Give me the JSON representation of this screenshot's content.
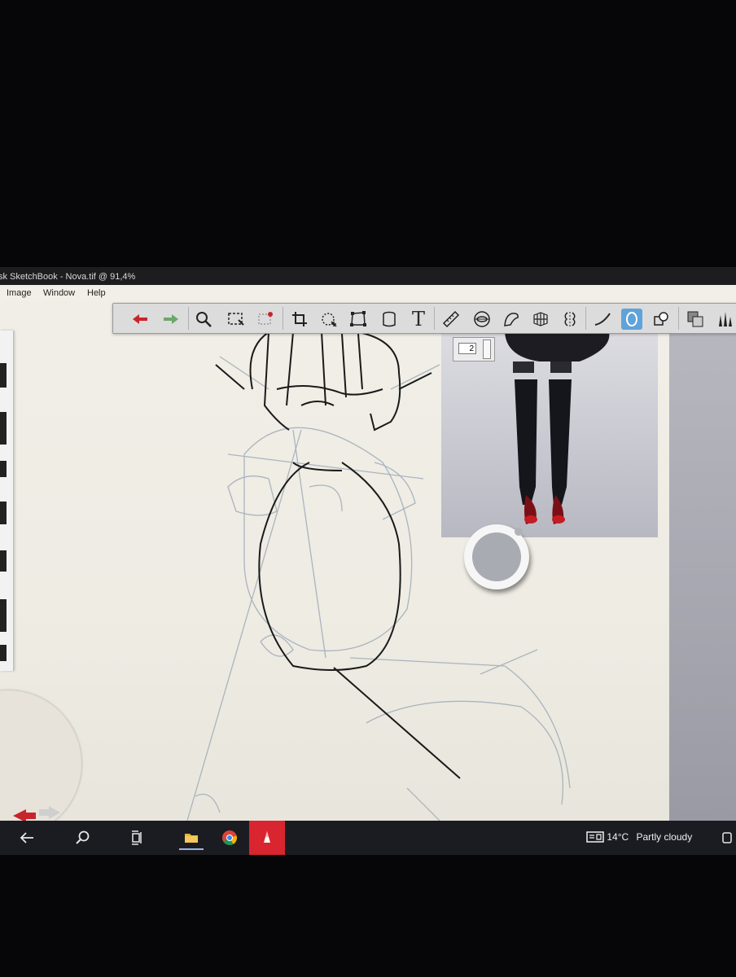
{
  "window": {
    "title": "sk SketchBook - Nova.tif @ 91,4%"
  },
  "menu": {
    "items": [
      "Image",
      "Window",
      "Help"
    ]
  },
  "toolbar": {
    "tools": [
      "undo",
      "redo",
      "zoom",
      "select",
      "lasso-select",
      "crop",
      "transform",
      "distort",
      "fill",
      "text",
      "ruler",
      "ellipse-guide",
      "french-curve",
      "perspective",
      "symmetry",
      "stroke",
      "predictive-stroke",
      "shapes",
      "layers",
      "brushes"
    ],
    "active_tool": "predictive-stroke"
  },
  "layer_panel": {
    "layer_number": "2"
  },
  "colors": {
    "accent": "#5fa3d9",
    "undo_red": "#c8242a",
    "redo_green": "#6aa86a",
    "current_color": "#a9abb2",
    "taskbar_app": "#d9252f"
  },
  "taskbar": {
    "weather_temp": "14°C",
    "weather_text": "Partly cloudy",
    "apps": [
      "back",
      "search",
      "task-view",
      "file-explorer",
      "chrome",
      "sketchbook"
    ]
  }
}
